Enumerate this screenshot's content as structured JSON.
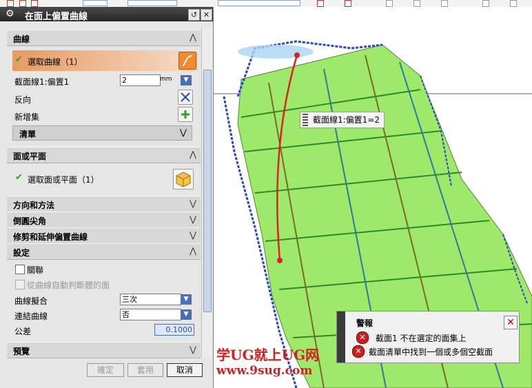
{
  "dialog": {
    "title": "在面上偏置曲線",
    "sections": {
      "curves": {
        "title": "曲線",
        "select_curve": "選取曲線（1）",
        "offset_label": "截面線1:偏置1",
        "offset_value": "2",
        "offset_unit": "mm",
        "reverse": "反向",
        "new_set": "新增集",
        "list_label": "清單"
      },
      "face": {
        "title": "面或平面",
        "select_face": "選取面或平面（1）"
      },
      "direction": {
        "title": "方向和方法"
      },
      "fillet": {
        "title": "倒圓尖角"
      },
      "trim": {
        "title": "修剪和延伸偏置曲線"
      },
      "settings": {
        "title": "設定",
        "associative": "關聯",
        "auto_judge": "從曲線自動判斷體的面",
        "curve_fit_label": "曲線擬合",
        "curve_fit_value": "三次",
        "connect_label": "連結曲線",
        "connect_value": "否",
        "tolerance_label": "公差",
        "tolerance_value": "0.1000"
      },
      "preview": {
        "title": "預覽"
      }
    },
    "buttons": {
      "ok": "確定",
      "apply": "套用",
      "cancel": "取消"
    }
  },
  "viewport": {
    "tooltip": "截面線1:偏置1=2",
    "warning": {
      "title": "警報",
      "line1": "截面1 不在選定的面集上",
      "line2": "截面清單中找到一個或多個空截面"
    },
    "watermark": {
      "line1": "学UG就上UG网",
      "line2": "www.9sug.com"
    }
  },
  "colors": {
    "accent": "#e79a62",
    "surface": "#9ee86a",
    "curve": "#e02020",
    "error": "#c82020"
  }
}
